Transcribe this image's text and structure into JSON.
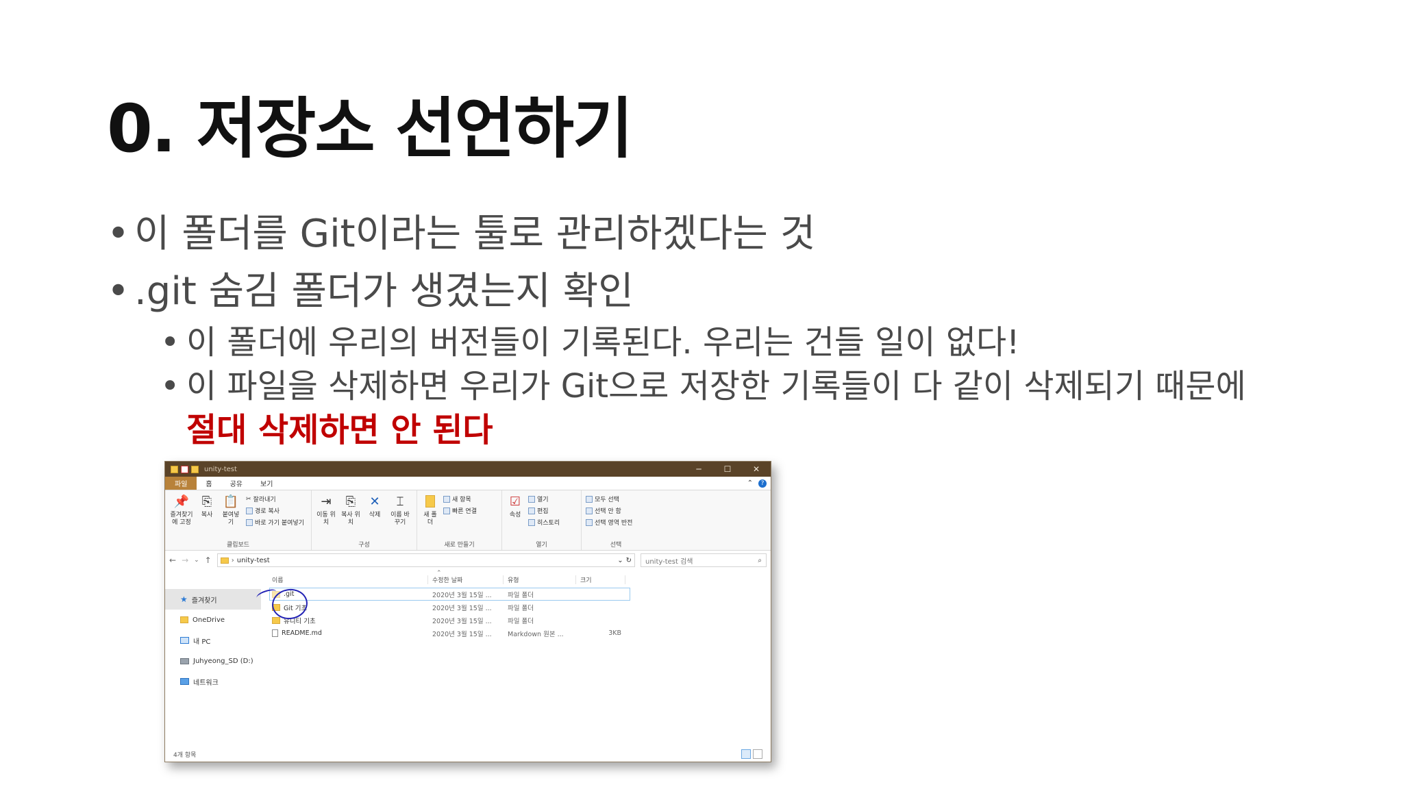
{
  "slide": {
    "title": "0. 저장소 선언하기",
    "bullets": [
      "이 폴더를 Git이라는 툴로 관리하겠다는 것",
      ".git 숨김 폴더가 생겼는지 확인"
    ],
    "sub_bullets": [
      "이 폴더에 우리의 버전들이 기록된다. 우리는 건들 일이 없다!",
      "이 파일을 삭제하면 우리가 Git으로 저장한 기록들이 다 같이 삭제되기 때문에"
    ],
    "emphasis": "절대 삭제하면 안 된다",
    "bullet_glyph": "•",
    "emphasis_color": "#c00000"
  },
  "explorer": {
    "window_title": "unity-test",
    "controls": {
      "minimize": "─",
      "maximize": "☐",
      "close": "✕"
    },
    "tabs": [
      "파일",
      "홈",
      "공유",
      "보기"
    ],
    "ribbon": {
      "clipboard": {
        "label": "클립보드",
        "pin": "즐겨찾기에 고정",
        "copy": "복사",
        "paste": "붙여넣기",
        "cut": "잘라내기",
        "copy_path": "경로 복사",
        "paste_shortcut": "바로 가기 붙여넣기"
      },
      "organize": {
        "label": "구성",
        "move_to": "이동 위치",
        "copy_to": "복사 위치",
        "delete": "삭제",
        "rename": "이름 바꾸기"
      },
      "new": {
        "label": "새로 만들기",
        "new_folder": "새 폴더",
        "new_item": "새 항목",
        "easy_access": "빠른 연결"
      },
      "open": {
        "label": "열기",
        "properties": "속성",
        "open": "열기",
        "edit": "편집",
        "history": "히스토리"
      },
      "select": {
        "label": "선택",
        "select_all": "모두 선택",
        "select_none": "선택 안 함",
        "invert": "선택 영역 반전"
      }
    },
    "address": {
      "path": "unity-test",
      "search_placeholder": "unity-test 검색"
    },
    "nav_pane": [
      "즐겨찾기",
      "OneDrive",
      "내 PC",
      "Juhyeong_SD (D:)",
      "네트워크"
    ],
    "columns": {
      "name": "이름",
      "date": "수정한 날짜",
      "type": "유형",
      "size": "크기"
    },
    "files": [
      {
        "name": ".git",
        "date": "2020년 3월 15일 ...",
        "type": "파일 폴더",
        "size": ""
      },
      {
        "name": "Git 기초",
        "date": "2020년 3월 15일 ...",
        "type": "파일 폴더",
        "size": ""
      },
      {
        "name": "유니티 기초",
        "date": "2020년 3월 15일 ...",
        "type": "파일 폴더",
        "size": ""
      },
      {
        "name": "README.md",
        "date": "2020년 3월 15일 ...",
        "type": "Markdown 원본 ...",
        "size": "3KB"
      }
    ],
    "status": "4개 항목"
  }
}
